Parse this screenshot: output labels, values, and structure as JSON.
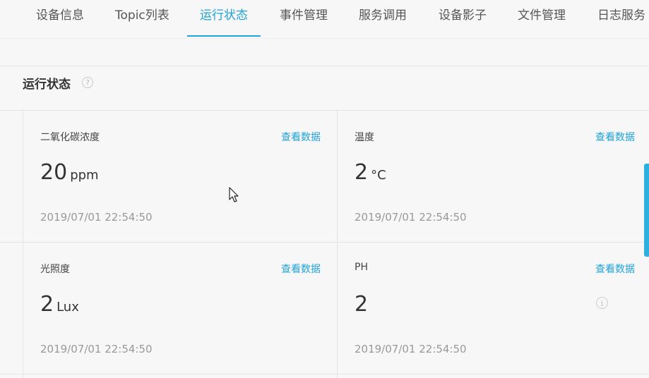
{
  "tabs": [
    {
      "label": "设备信息",
      "active": false
    },
    {
      "label": "Topic列表",
      "active": false
    },
    {
      "label": "运行状态",
      "active": true
    },
    {
      "label": "事件管理",
      "active": false
    },
    {
      "label": "服务调用",
      "active": false
    },
    {
      "label": "设备影子",
      "active": false
    },
    {
      "label": "文件管理",
      "active": false
    },
    {
      "label": "日志服务",
      "active": false
    }
  ],
  "section": {
    "title": "运行状态",
    "help_icon": "?"
  },
  "cards": [
    {
      "name": "二氧化碳浓度",
      "link": "查看数据",
      "value": "20",
      "unit": "ppm",
      "time": "2019/07/01 22:54:50"
    },
    {
      "name": "温度",
      "link": "查看数据",
      "value": "2",
      "unit": "°C",
      "time": "2019/07/01 22:54:50"
    },
    {
      "name": "光照度",
      "link": "查看数据",
      "value": "2",
      "unit": "Lux",
      "time": "2019/07/01 22:54:50"
    },
    {
      "name": "PH",
      "link": "查看数据",
      "value": "2",
      "unit": "",
      "time": "2019/07/01 22:54:50",
      "info_icon": "i"
    }
  ],
  "colors": {
    "accent": "#1fa3d8",
    "text": "#333333",
    "muted": "#999999",
    "background": "#f7f7f7"
  }
}
